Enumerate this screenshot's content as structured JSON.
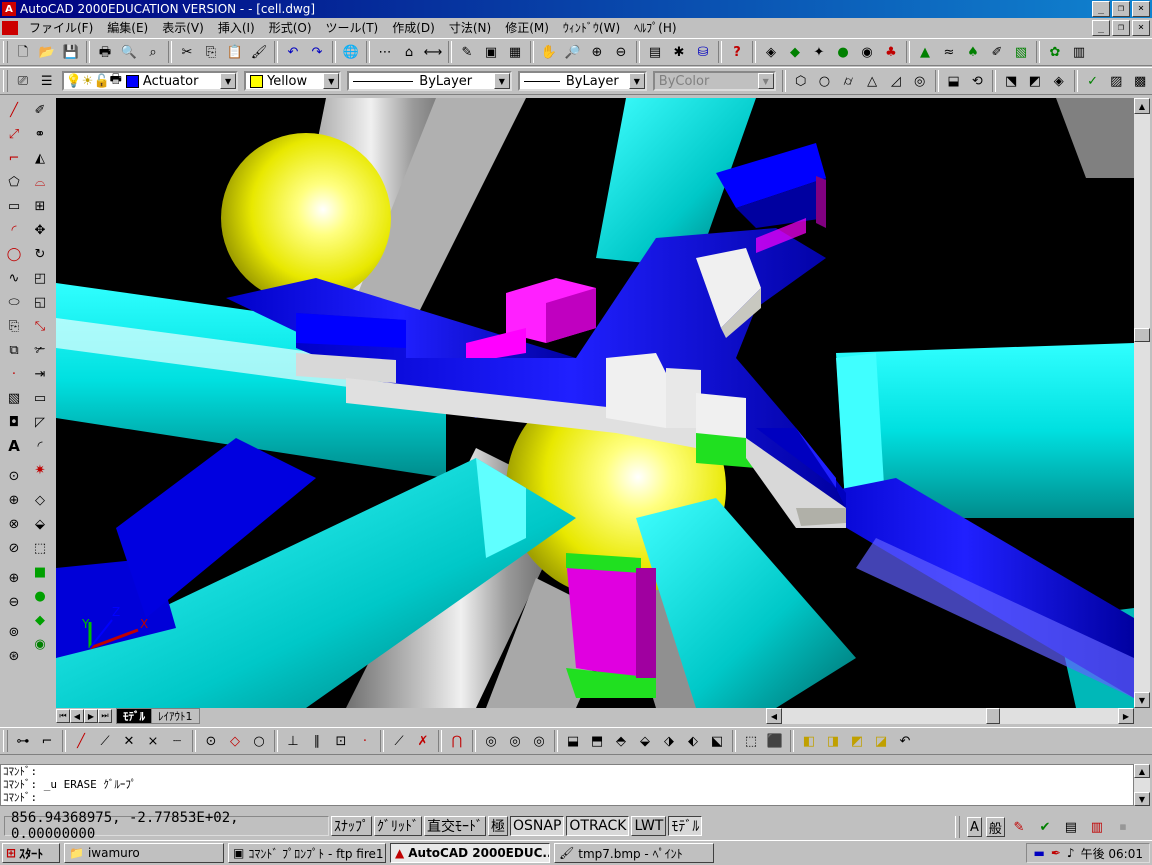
{
  "window": {
    "title": "AutoCAD 2000EDUCATION VERSION - - [cell.dwg]",
    "min": "_",
    "max": "□",
    "close": "×",
    "restore": "❐"
  },
  "menu": [
    "ファイル(F)",
    "編集(E)",
    "表示(V)",
    "挿入(I)",
    "形式(O)",
    "ツール(T)",
    "作成(D)",
    "寸法(N)",
    "修正(M)",
    "ｳｨﾝﾄﾞｳ(W)",
    "ﾍﾙﾌﾟ(H)"
  ],
  "layers": {
    "layer_name": "Actuator",
    "color_name": "Yellow",
    "linetype": "ByLayer",
    "lineweight": "ByLayer",
    "plotstyle": "ByColor",
    "layer_color": "#0000ff",
    "swatch_color": "#ffff00"
  },
  "layout_tabs": [
    "ﾓﾃﾞﾙ",
    "ﾚｲｱｳﾄ1"
  ],
  "ucs": {
    "x": "X",
    "y": "Y",
    "z": "Z"
  },
  "command_lines": [
    "ｺﾏﾝﾄﾞ:",
    "ｺﾏﾝﾄﾞ:  _u ERASE ｸﾞﾙｰﾌﾟ",
    "ｺﾏﾝﾄﾞ:"
  ],
  "status": {
    "coords": "856.94368975, -2.77853E+02, 0.00000000",
    "toggles": [
      "ｽﾅｯﾌﾟ",
      "ｸﾞﾘｯﾄﾞ",
      "直交ﾓｰﾄﾞ",
      "極",
      "OSNAP",
      "OTRACK",
      "LWT",
      "ﾓﾃﾞﾙ"
    ],
    "ime": [
      "A",
      "般"
    ]
  },
  "taskbar": {
    "start": "ｽﾀｰﾄ",
    "tasks": [
      "iwamuro",
      "ｺﾏﾝﾄﾞ ﾌﾟﾛﾝﾌﾟﾄ - ftp fire1",
      "AutoCAD 2000EDUC...",
      "tmp7.bmp - ﾍﾟｲﾝﾄ"
    ],
    "clock": "午後 06:01"
  }
}
